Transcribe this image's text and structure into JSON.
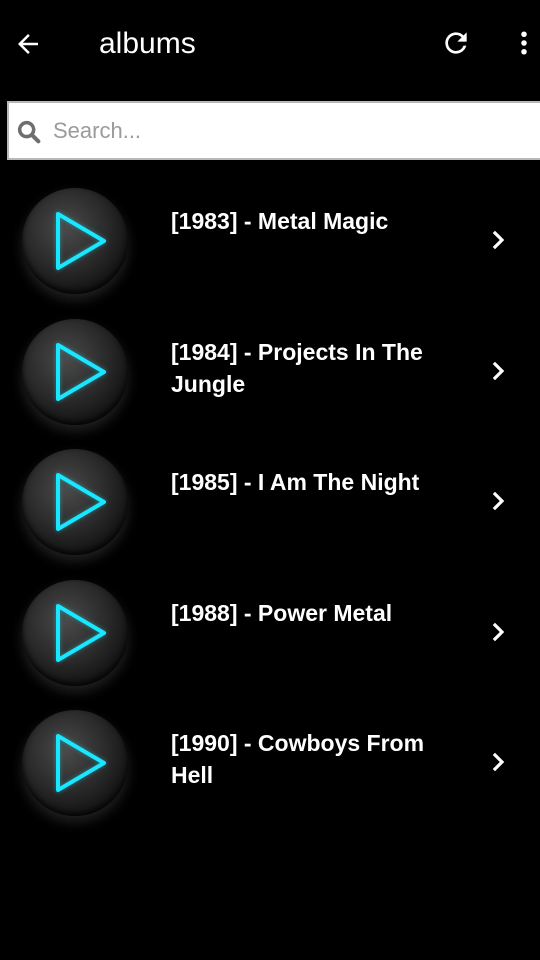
{
  "header": {
    "title": "albums",
    "back_icon": "arrow-left-icon",
    "refresh_icon": "refresh-icon",
    "more_icon": "more-vertical-icon"
  },
  "search": {
    "placeholder": "Search...",
    "value": "",
    "icon": "search-icon"
  },
  "albums": [
    {
      "title": "[1983] - Metal Magic"
    },
    {
      "title": "[1984] - Projects In The Jungle"
    },
    {
      "title": "[1985] - I Am The Night"
    },
    {
      "title": "[1988] - Power Metal"
    },
    {
      "title": "[1990] - Cowboys From Hell"
    }
  ],
  "colors": {
    "background": "#000000",
    "accent_glow": "#19e6ff",
    "text": "#ffffff",
    "placeholder": "#9b9b9b"
  }
}
